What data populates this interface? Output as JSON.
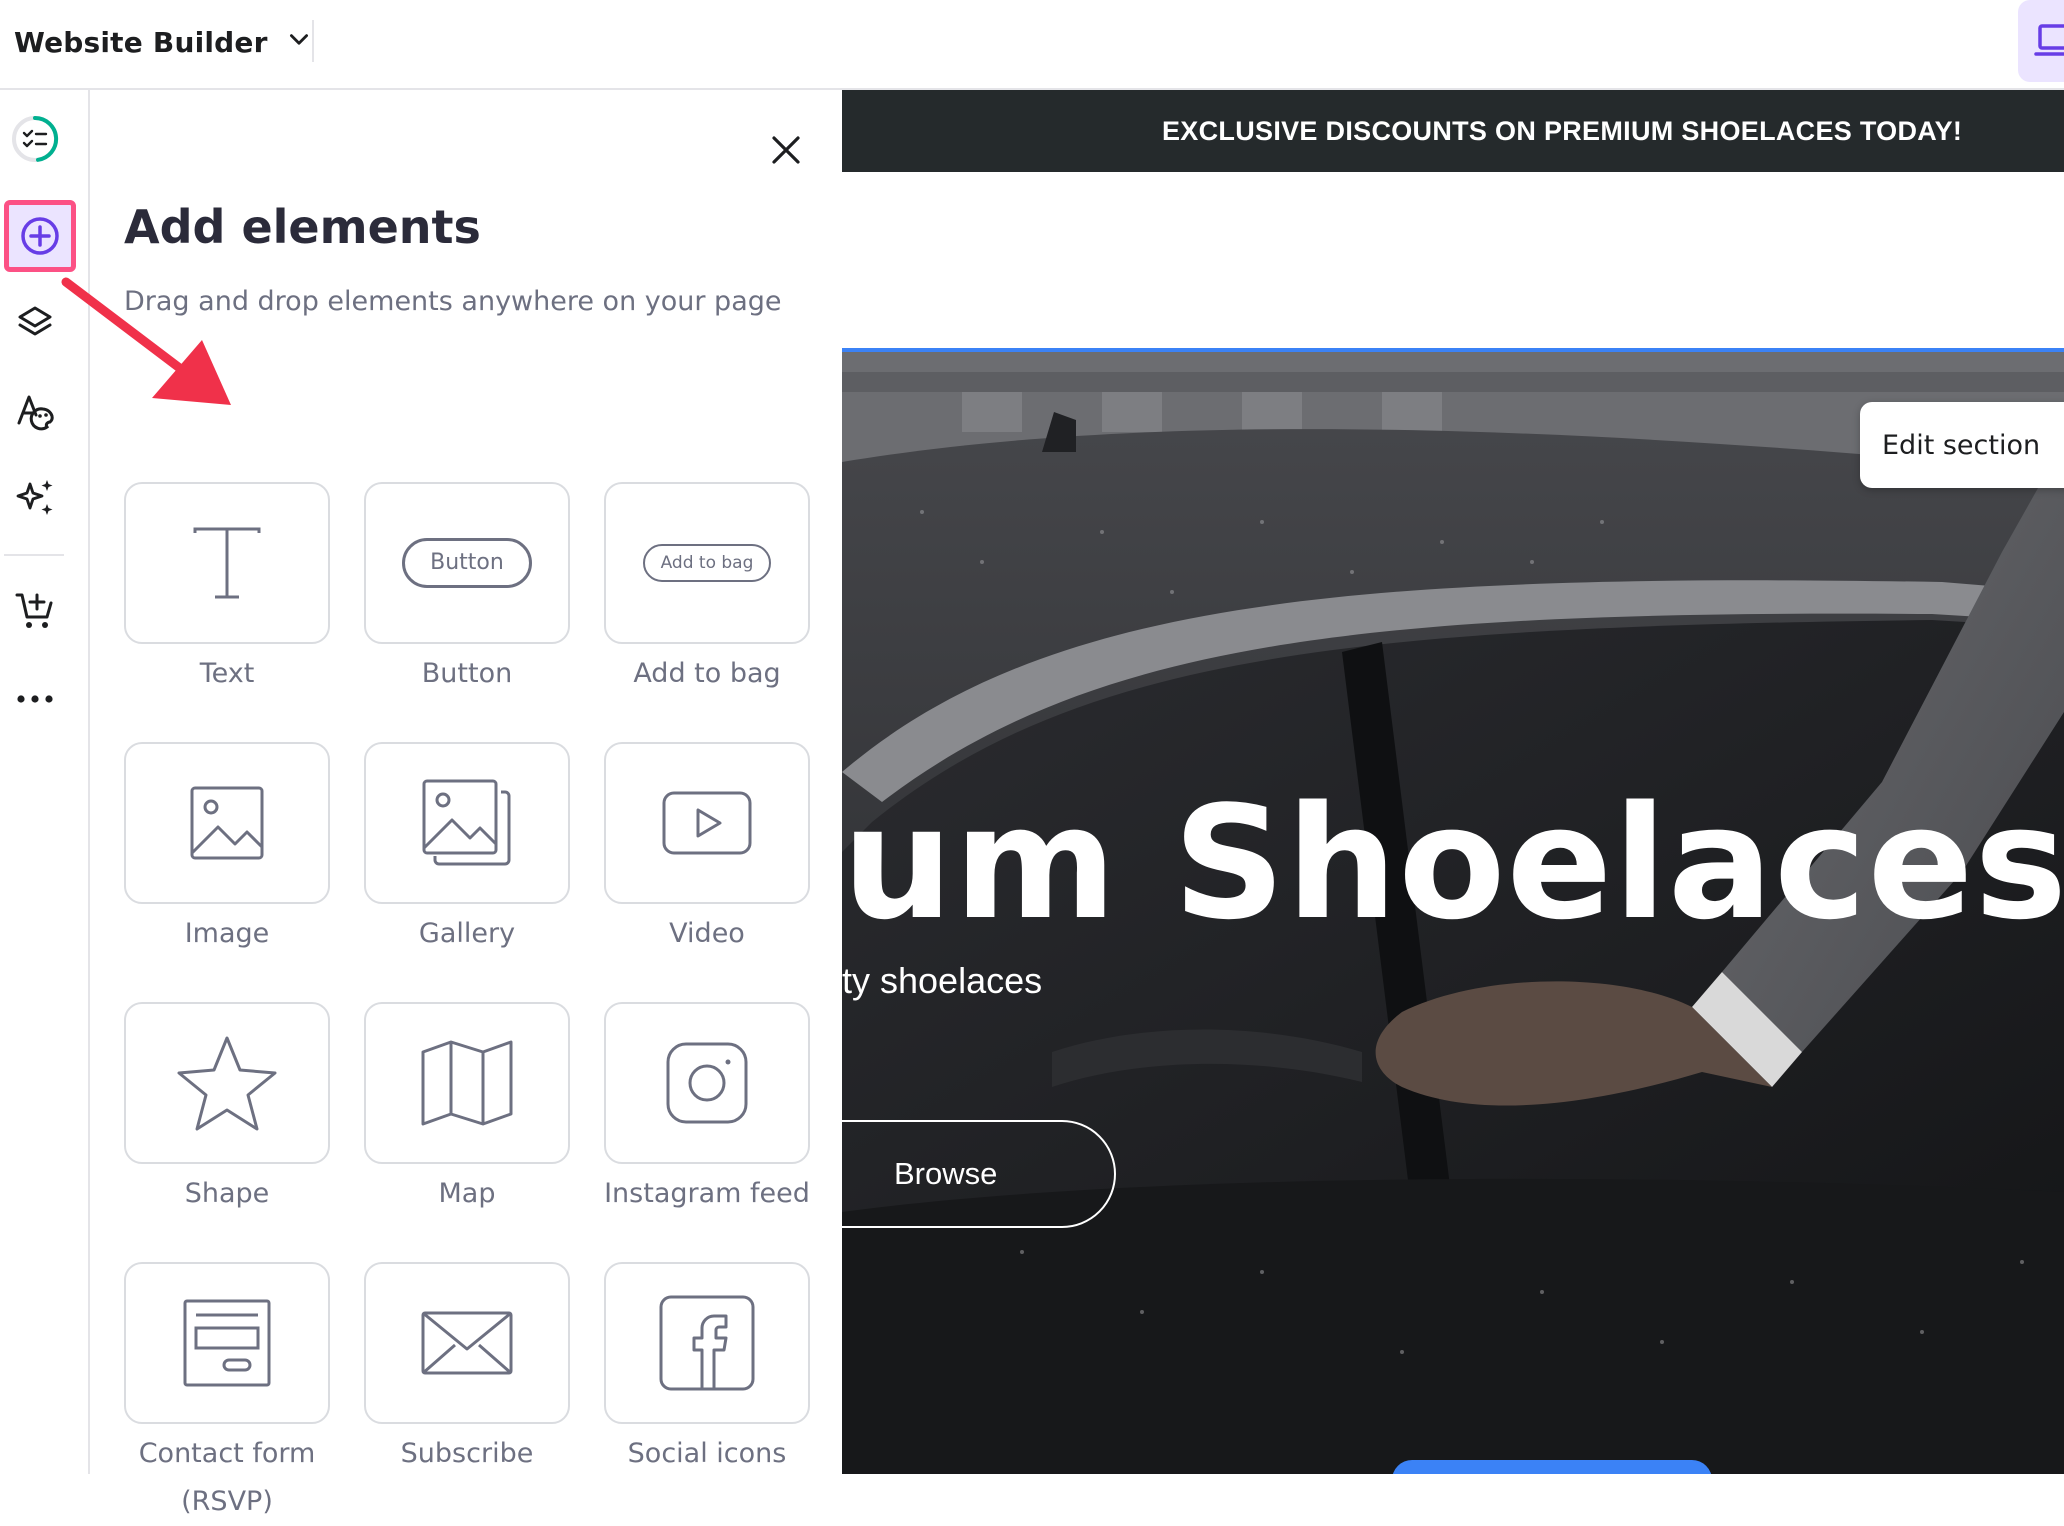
{
  "topbar": {
    "site_title": "Website Builder"
  },
  "rail": {
    "items": [
      "progress-checklist",
      "add-elements",
      "layers",
      "styles",
      "ai-tools",
      "add-to-cart",
      "more"
    ]
  },
  "panel": {
    "title": "Add elements",
    "subtitle": "Drag and drop elements anywhere on your page",
    "tiles": [
      {
        "label": "Text",
        "icon": "text-icon"
      },
      {
        "label": "Button",
        "icon": "button-icon",
        "preview": "Button"
      },
      {
        "label": "Add to bag",
        "icon": "add-to-bag-icon",
        "preview": "Add to bag"
      },
      {
        "label": "Image",
        "icon": "image-icon"
      },
      {
        "label": "Gallery",
        "icon": "gallery-icon"
      },
      {
        "label": "Video",
        "icon": "video-icon"
      },
      {
        "label": "Shape",
        "icon": "star-icon"
      },
      {
        "label": "Map",
        "icon": "map-icon"
      },
      {
        "label": "Instagram feed",
        "icon": "instagram-icon"
      },
      {
        "label": "Contact form (RSVP)",
        "icon": "contact-form-icon"
      },
      {
        "label": "Subscribe",
        "icon": "envelope-icon"
      },
      {
        "label": "Social icons",
        "icon": "facebook-icon"
      }
    ]
  },
  "canvas": {
    "promo_text": "EXCLUSIVE DISCOUNTS ON PREMIUM SHOELACES TODAY!",
    "hero_title": "um Shoelaces",
    "hero_subtitle": "ty shoelaces",
    "browse_label": "Browse",
    "edit_section_label": "Edit section"
  },
  "colors": {
    "accent": "#673de6",
    "highlight": "#fc5185",
    "promo_bg": "#252a2c",
    "selection_border": "#3b82f6"
  }
}
